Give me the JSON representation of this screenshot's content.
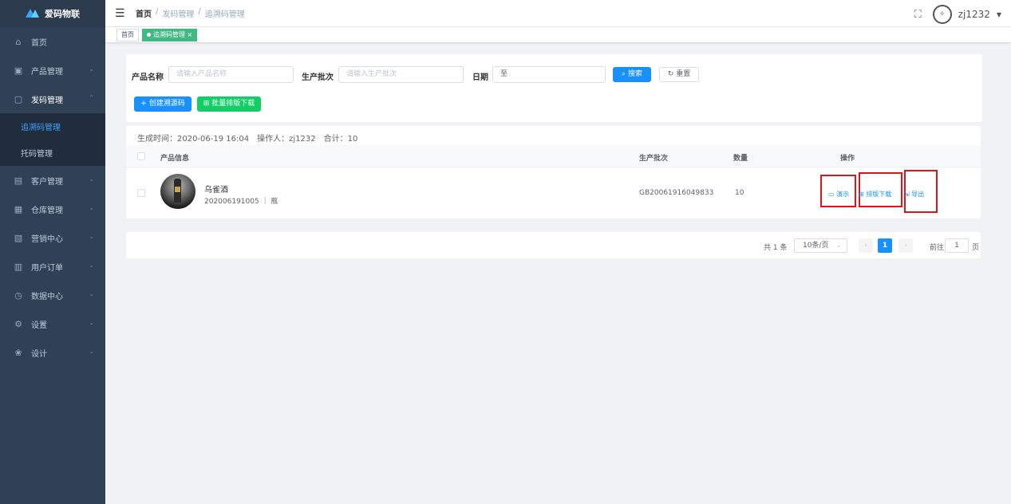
{
  "brand": {
    "name": "爱码物联"
  },
  "sidebar": {
    "items": [
      {
        "label": "首页",
        "icon": "home-icon",
        "glyph": "⌂"
      },
      {
        "label": "产品管理",
        "icon": "product-icon",
        "glyph": "▣"
      },
      {
        "label": "发码管理",
        "icon": "code-icon",
        "glyph": "▢"
      },
      {
        "label": "客户管理",
        "icon": "customer-icon",
        "glyph": "▤"
      },
      {
        "label": "仓库管理",
        "icon": "warehouse-icon",
        "glyph": "▦"
      },
      {
        "label": "营销中心",
        "icon": "marketing-icon",
        "glyph": "▧"
      },
      {
        "label": "用户订单",
        "icon": "order-icon",
        "glyph": "▥"
      },
      {
        "label": "数据中心",
        "icon": "data-icon",
        "glyph": "◷"
      },
      {
        "label": "设置",
        "icon": "settings-icon",
        "glyph": "⚙"
      },
      {
        "label": "设计",
        "icon": "design-icon",
        "glyph": "❀"
      }
    ],
    "sub": [
      {
        "label": "追溯码管理"
      },
      {
        "label": "托码管理"
      }
    ]
  },
  "topbar": {
    "breadcrumb": [
      "首页",
      "/",
      "发码管理",
      "/",
      "追溯码管理"
    ],
    "user": "zj1232",
    "caret": "▼"
  },
  "tags": [
    {
      "label": "首页"
    },
    {
      "label": "追溯码管理",
      "close": "×"
    }
  ],
  "filters": {
    "name_label": "产品名称",
    "name_placeholder": "请输入产品名称",
    "batch_label": "生产批次",
    "batch_placeholder": "请输入生产批次",
    "date_label": "日期",
    "date_sep": "至",
    "search_btn": "搜索",
    "reset_btn": "重置",
    "create_btn": "创建溯源码",
    "batch_download_btn": "批量排版下载"
  },
  "summary": "生成时间：2020-06-19 16:04　操作人：zj1232　合计：10",
  "table": {
    "headers": [
      "产品信息",
      "生产批次",
      "数量",
      "操作"
    ],
    "rows": [
      {
        "name": "乌雀酒",
        "code": "202006191005 ｜ 瓶",
        "batch": "GB20061916049833",
        "qty": "10",
        "actions": [
          "演示",
          "排版下载",
          "导出"
        ]
      }
    ]
  },
  "pagination": {
    "total": "共 1 条",
    "size": "10条/页",
    "page": "1",
    "goto": "前往",
    "goto_value": "1",
    "page_unit": "页"
  }
}
